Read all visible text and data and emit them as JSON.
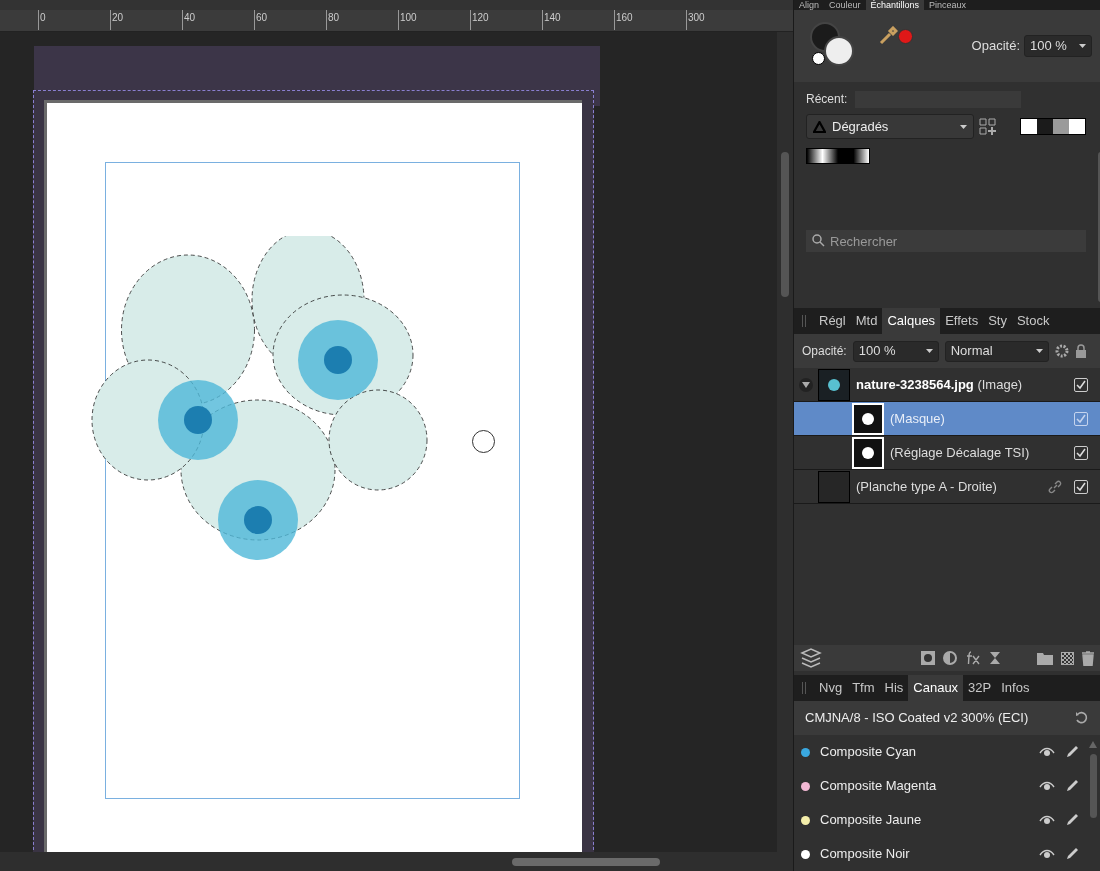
{
  "ruler": {
    "ticks": [
      "0",
      "20",
      "40",
      "60",
      "80",
      "100",
      "120",
      "140",
      "160",
      "300"
    ]
  },
  "top_tabs": [
    {
      "label": "Align",
      "selected": false
    },
    {
      "label": "Couleur",
      "selected": false
    },
    {
      "label": "Échantillons",
      "selected": true
    },
    {
      "label": "Pinceaux",
      "selected": false
    }
  ],
  "color": {
    "opacity_label": "Opacité:",
    "opacity_value": "100 %"
  },
  "swatches": {
    "recent_label": "Récent:",
    "category": "Dégradés",
    "search_placeholder": "Rechercher"
  },
  "layer_tabs": [
    {
      "label": "Régl",
      "selected": false
    },
    {
      "label": "Mtd",
      "selected": false
    },
    {
      "label": "Calques",
      "selected": true
    },
    {
      "label": "Effets",
      "selected": false
    },
    {
      "label": "Sty",
      "selected": false
    },
    {
      "label": "Stock",
      "selected": false
    }
  ],
  "layers_bar": {
    "opacity_label": "Opacité:",
    "opacity_value": "100 %",
    "blend_mode": "Normal"
  },
  "layers": [
    {
      "name": "nature-3238564.jpg",
      "type": "(Image)",
      "expanded": true,
      "selected": false,
      "checked": true,
      "linked": false,
      "children": [
        {
          "name": "(Masque)",
          "selected": true,
          "checked": true,
          "linked": false
        },
        {
          "name": "(Réglage Décalage TSI)",
          "selected": false,
          "checked": true,
          "linked": false
        }
      ]
    },
    {
      "name": "(Planche type A - Droite)",
      "selected": false,
      "checked": true,
      "linked": true
    }
  ],
  "channel_tabs": [
    {
      "label": "Nvg",
      "selected": false
    },
    {
      "label": "Tfm",
      "selected": false
    },
    {
      "label": "His",
      "selected": false
    },
    {
      "label": "Canaux",
      "selected": true
    },
    {
      "label": "32P",
      "selected": false
    },
    {
      "label": "Infos",
      "selected": false
    }
  ],
  "channels": {
    "profile": "CMJNA/8 - ISO Coated v2 300% (ECI)",
    "items": [
      {
        "name": "Composite Cyan",
        "color": "#3aa8e0"
      },
      {
        "name": "Composite Magenta",
        "color": "#f2b8d4"
      },
      {
        "name": "Composite Jaune",
        "color": "#f4eeaa"
      },
      {
        "name": "Composite Noir",
        "color": "#ffffff"
      }
    ]
  }
}
